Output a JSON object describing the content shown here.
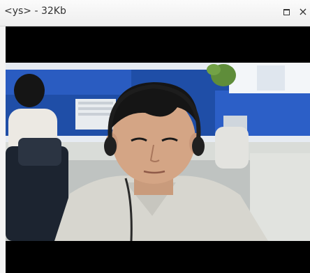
{
  "window": {
    "title": "<ys> - 32Kb",
    "restore_icon": "restore-icon",
    "close_icon": "close-icon",
    "close_glyph": "×"
  },
  "video": {
    "description_icon": "webcam-video-feed"
  }
}
